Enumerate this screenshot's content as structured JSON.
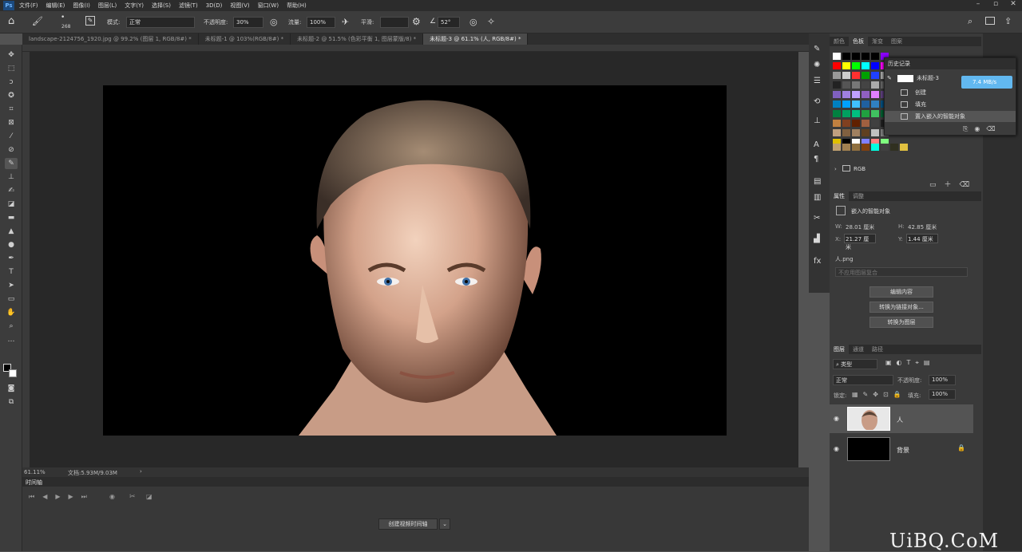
{
  "app": {
    "logo": "Ps",
    "menu": [
      "文件(F)",
      "编辑(E)",
      "图像(I)",
      "图层(L)",
      "文字(Y)",
      "选择(S)",
      "滤镜(T)",
      "3D(D)",
      "视图(V)",
      "窗口(W)",
      "帮助(H)"
    ]
  },
  "options": {
    "brush_size": "268",
    "mode_label": "模式:",
    "mode_value": "正常",
    "opacity_label": "不透明度:",
    "opacity_value": "30%",
    "flow_label": "流量:",
    "flow_value": "100%",
    "smooth_label": "平滑:",
    "angle_value": "52°"
  },
  "tabs": [
    {
      "label": "landscape-2124756_1920.jpg @ 99.2% (图层 1, RGB/8#) *"
    },
    {
      "label": "未标题-1 @ 103%(RGB/8#) *"
    },
    {
      "label": "未标题-2 @ 51.5% (色彩平衡 1, 图层蒙版/8) *"
    },
    {
      "label": "未标题-3 @ 61.1% (人, RGB/8#) *"
    }
  ],
  "status": {
    "zoom": "61.11%",
    "doc": "文档:5.93M/9.03M"
  },
  "timeline": {
    "title": "时间轴",
    "create_btn": "创建视频时间轴"
  },
  "swatches_panel": {
    "tabs": [
      "颜色",
      "色板",
      "渐变",
      "图案"
    ],
    "group": "RGB"
  },
  "history_panel": {
    "title": "历史记录",
    "snapshot": "未标题-3",
    "items": [
      "创建",
      "填充",
      "置入嵌入的智能对象"
    ],
    "speed": "7.4 MB/s"
  },
  "properties_panel": {
    "tabs": [
      "属性",
      "调整"
    ],
    "type": "嵌入的智能对象",
    "w_label": "W:",
    "w": "28.01 厘米",
    "h_label": "H:",
    "h": "42.85 厘米",
    "x_label": "X:",
    "x": "21.27 厘米",
    "y_label": "Y:",
    "y": "1.44 厘米",
    "file": "人.png",
    "comp": "不应用图层复合",
    "btn_edit": "编辑内容",
    "btn_convert_linked": "转换为链接对象...",
    "btn_convert_layer": "转换为图层"
  },
  "layers_panel": {
    "tabs": [
      "图层",
      "通道",
      "路径"
    ],
    "filter": "类型",
    "blend": "正常",
    "opacity_label": "不透明度:",
    "opacity": "100%",
    "lock_label": "锁定:",
    "fill_label": "填充:",
    "fill": "100%",
    "layers": [
      {
        "name": "人"
      },
      {
        "name": "背景"
      }
    ]
  },
  "watermark": "UiBQ.CoM"
}
